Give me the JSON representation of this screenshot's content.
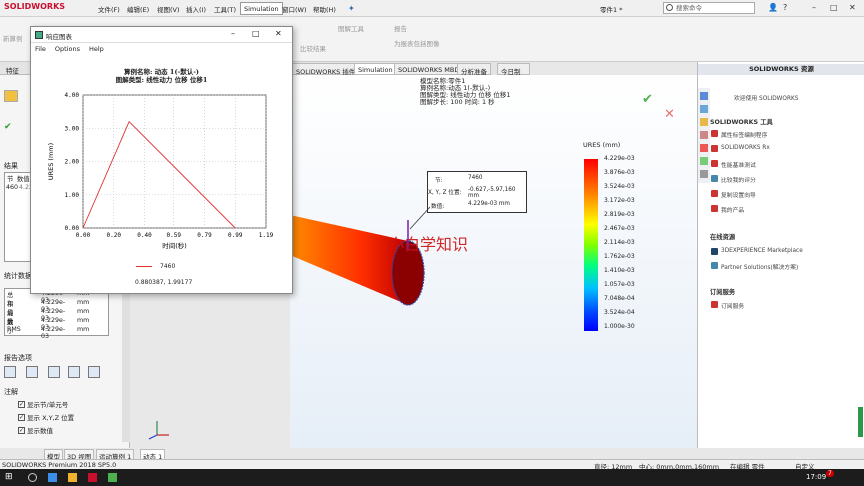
{
  "app": {
    "logo": "SOLIDWORKS",
    "edition": "SOLIDWORKS Premium 2018 SP5.0"
  },
  "menu": [
    "文件(F)",
    "编辑(E)",
    "视图(V)",
    "插入(I)",
    "工具(T)",
    "Simulation",
    "窗口(W)",
    "帮助(H)"
  ],
  "title": {
    "part": "零件1 *",
    "search_placeholder": "搜索命令"
  },
  "toolbar": {
    "new_study": "新算例",
    "compare": "比较结果",
    "plot_tools": "图解工具",
    "report": "报告",
    "include_image": "为报表包括图像"
  },
  "viewport_tabs": [
    "SOLIDWORKS 插件",
    "Simulation",
    "SOLIDWORKS MBD",
    "分析准备",
    "今日制造"
  ],
  "left_panel": {
    "tab_label": "特征",
    "results_title": "结果",
    "results_header": [
      "节",
      "数值"
    ],
    "results_row": [
      "460",
      "4.229e"
    ],
    "stats_title": "统计数据",
    "stats": [
      {
        "label": "总和",
        "value": "4.229e-03",
        "unit": "mm"
      },
      {
        "label": "平均数",
        "value": "4.229e-03",
        "unit": "mm"
      },
      {
        "label": "最大",
        "value": "4.229e-03",
        "unit": "mm"
      },
      {
        "label": "最小",
        "value": "4.229e-03",
        "unit": "mm"
      },
      {
        "label": "RMS",
        "value": "4.229e-03",
        "unit": "mm"
      }
    ],
    "report_options": "报告选项",
    "notes": "注解",
    "checks": [
      "显示节/单元号",
      "显示 X,Y,Z 位置",
      "显示数值"
    ]
  },
  "dialog": {
    "title": "响应图表",
    "menu": [
      "File",
      "Options",
      "Help"
    ],
    "chart_title_line1": "算例名称: 动态 1(-默认-)",
    "chart_title_line2": "图解类型: 线性动力 位移 位移1",
    "legend": "7460",
    "cursor_readout": "0.880387,  1.99177"
  },
  "chart_data": {
    "type": "line",
    "xlabel": "时间(秒)",
    "ylabel": "URES (mm)",
    "xlim": [
      0,
      1.19
    ],
    "ylim": [
      0,
      4.0
    ],
    "xticks": [
      "0.00",
      "0.20",
      "0.40",
      "0.59",
      "0.79",
      "0.99",
      "1.19"
    ],
    "yticks": [
      "0.00",
      "1.00",
      "2.00",
      "3.00",
      "4.00"
    ],
    "series": [
      {
        "name": "7460",
        "x": [
          0,
          0.3,
          0.99
        ],
        "y": [
          0,
          3.2,
          0
        ]
      }
    ]
  },
  "viewport": {
    "model_info": [
      "模型名称:零件1",
      "算例名称:动态 1(-默认-)",
      "图解类型: 线性动力 位移 位移1",
      "图解步长: 100  时间: 1 秒"
    ],
    "probe": {
      "node_label": "节:",
      "node_value": "7460",
      "xyz_label": "X, Y, Z 位置:",
      "xyz_value": "-0.627,-5.97,160 mm",
      "value_label": "数值:",
      "value_value": "4.229e-03  mm"
    },
    "watermark": "小白学知识",
    "legend_title": "URES (mm)",
    "legend_values": [
      "4.229e-03",
      "3.876e-03",
      "3.524e-03",
      "3.172e-03",
      "2.819e-03",
      "2.467e-03",
      "2.114e-03",
      "1.762e-03",
      "1.410e-03",
      "1.057e-03",
      "7.048e-04",
      "3.524e-04",
      "1.000e-30"
    ]
  },
  "right_panel": {
    "header": "SOLIDWORKS 资源",
    "welcome": "欢迎使用 SOLIDWORKS",
    "tools_title": "SOLIDWORKS 工具",
    "tools": [
      "属性标签编制程序",
      "SOLIDWORKS Rx",
      "性能基准测试",
      "比较我的评分",
      "复制设置向导",
      "我的产品"
    ],
    "online_title": "在线资源",
    "online": [
      "3DEXPERIENCE Marketplace",
      "Partner Solutions(解决方案)"
    ],
    "sub_title": "订阅服务",
    "sub": [
      "订阅服务"
    ]
  },
  "bottom_tabs": [
    "模型",
    "3D 视图",
    "运动算例 1",
    "动态 1"
  ],
  "status": {
    "diameter": "直径: 12mm",
    "center": "中心: 0mm,0mm,160mm",
    "edit_mode": "在编辑 零件",
    "custom": "自定义"
  },
  "taskbar": {
    "time": "17:09",
    "badge": "7"
  }
}
